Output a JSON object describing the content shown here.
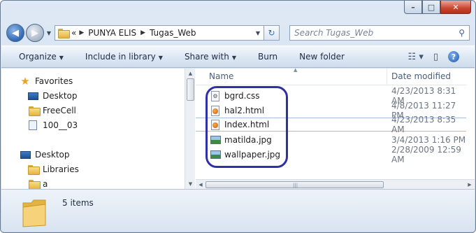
{
  "window": {
    "caption_buttons": [
      "–",
      "□",
      "✕"
    ]
  },
  "address": {
    "nav_back": "◀",
    "nav_forward": "▶",
    "overflow": "«",
    "crumbs": [
      "PUNYA ELIS",
      "Tugas_Web"
    ],
    "refresh_icon": "↻"
  },
  "search": {
    "placeholder": "Search Tugas_Web",
    "icon": "⚲"
  },
  "toolbar": {
    "organize": "Organize",
    "include": "Include in library",
    "share": "Share with",
    "burn": "Burn",
    "new_folder": "New folder"
  },
  "nav": {
    "favorites": "Favorites",
    "desktop_fav": "Desktop",
    "freecell": "FreeCell",
    "item_100": "100__03",
    "desktop": "Desktop",
    "libraries": "Libraries",
    "a": "a"
  },
  "columns": {
    "name": "Name",
    "date": "Date modified"
  },
  "files": [
    {
      "name": "bgrd.css",
      "date": "4/23/2013 8:31 AM",
      "icon": "css-file-icon"
    },
    {
      "name": "hal2.html",
      "date": "4/8/2013 11:27 PM",
      "icon": "html-file-icon"
    },
    {
      "name": "Index.html",
      "date": "4/23/2013 8:35 AM",
      "icon": "html-file-icon"
    },
    {
      "name": "matilda.jpg",
      "date": "3/4/2013 1:16 PM",
      "icon": "image-file-icon"
    },
    {
      "name": "wallpaper.jpg",
      "date": "2/28/2009 12:59 AM",
      "icon": "image-file-icon"
    }
  ],
  "selected_file": "Index.html",
  "details": {
    "count": "5 items"
  },
  "colors": {
    "highlight": "#2f2fa6",
    "toolbar": "#dce7f4",
    "selection_border": "#a4c1e3"
  }
}
